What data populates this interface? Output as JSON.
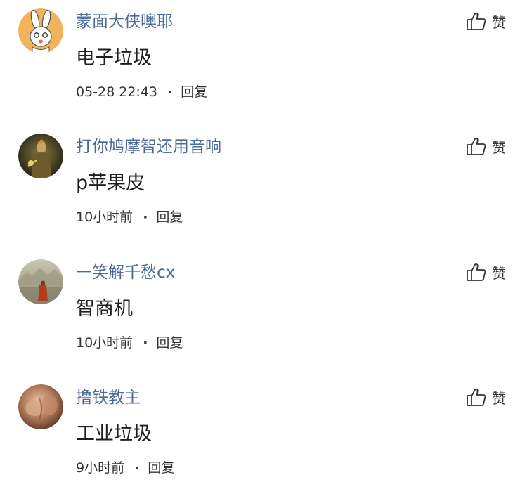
{
  "comments": [
    {
      "username": "蒙面大侠噢耶",
      "content": "电子垃圾",
      "time": "05-28 22:43",
      "separator": "·",
      "reply_label": "回复",
      "like_label": "赞",
      "avatar": "rabbit-cartoon-avatar"
    },
    {
      "username": "打你鸠摩智还用音响",
      "content": "p苹果皮",
      "time": "10小时前",
      "separator": "·",
      "reply_label": "回复",
      "like_label": "赞",
      "avatar": "warrior-photo-avatar"
    },
    {
      "username": "一笑解千愁cx",
      "content": "智商机",
      "time": "10小时前",
      "separator": "·",
      "reply_label": "回复",
      "like_label": "赞",
      "avatar": "monk-landscape-avatar"
    },
    {
      "username": "撸铁教主",
      "content": "工业垃圾",
      "time": "9小时前",
      "separator": "·",
      "reply_label": "回复",
      "like_label": "赞",
      "avatar": "muscle-photo-avatar"
    }
  ],
  "colors": {
    "username": "#4a6a98",
    "content": "#1e1e1e",
    "meta": "#333333",
    "background": "#ffffff"
  },
  "icons": {
    "like": "thumbs-up-icon"
  }
}
